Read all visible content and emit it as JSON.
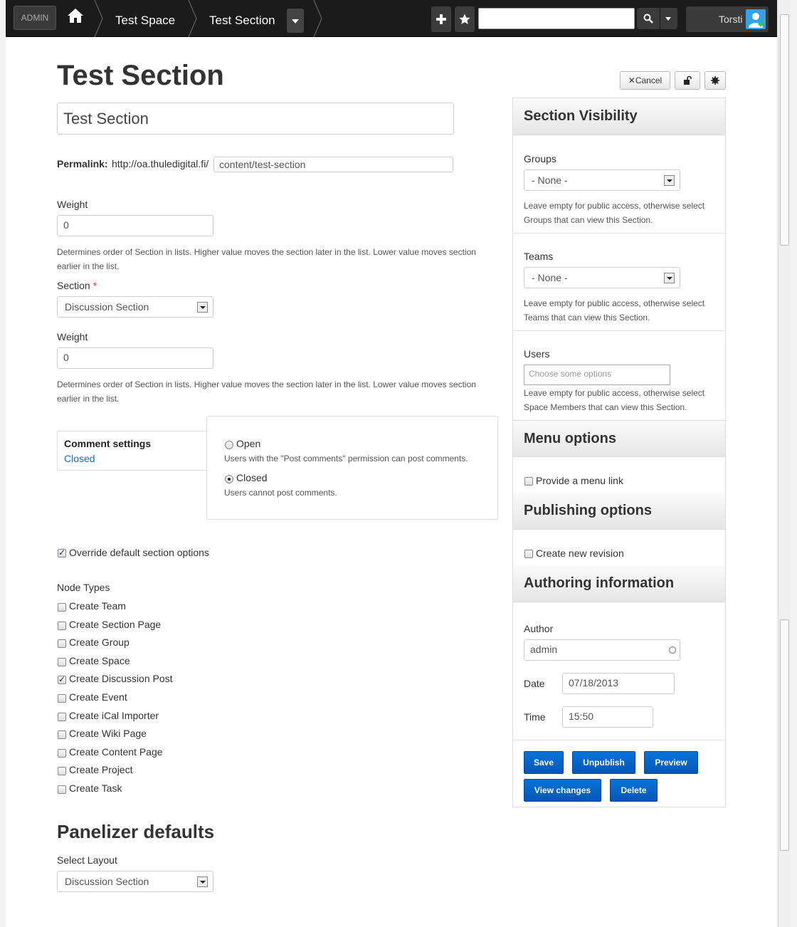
{
  "topbar": {
    "admin_label": "ADMIN",
    "breadcrumbs": [
      "Test Space",
      "Test Section"
    ],
    "user_name": "Torsti"
  },
  "page_title": "Test Section",
  "title_field_value": "Test Section",
  "actions": {
    "cancel_label": "Cancel"
  },
  "permalink": {
    "label": "Permalink:",
    "base": "http://oa.thuledigital.fi/",
    "path": "content/test-section"
  },
  "weight1": {
    "label": "Weight",
    "value": "0",
    "description_line1": "Determines order of Section in lists. Higher value moves the section later in the list. Lower value moves section",
    "description_line2": "earlier in the list."
  },
  "section": {
    "label": "Section",
    "required_mark": "*",
    "value": "Discussion Section"
  },
  "weight2": {
    "label": "Weight",
    "value": "0",
    "description_line1": "Determines order of Section in lists. Higher value moves the section later in the list. Lower value moves section",
    "description_line2": "earlier in the list."
  },
  "comment_settings": {
    "tab_title": "Comment settings",
    "tab_summary": "Closed",
    "open_label": "Open",
    "open_desc": "Users with the \"Post comments\" permission can post comments.",
    "closed_label": "Closed",
    "closed_desc": "Users cannot post comments.",
    "selected": "Closed"
  },
  "override_label": "Override default section options",
  "node_types": {
    "label": "Node Types",
    "items": [
      {
        "label": "Create Team",
        "checked": false
      },
      {
        "label": "Create Section Page",
        "checked": false
      },
      {
        "label": "Create Group",
        "checked": false
      },
      {
        "label": "Create Space",
        "checked": false
      },
      {
        "label": "Create Discussion Post",
        "checked": true
      },
      {
        "label": "Create Event",
        "checked": false
      },
      {
        "label": "Create iCal Importer",
        "checked": false
      },
      {
        "label": "Create Wiki Page",
        "checked": false
      },
      {
        "label": "Create Content Page",
        "checked": false
      },
      {
        "label": "Create Project",
        "checked": false
      },
      {
        "label": "Create Task",
        "checked": false
      }
    ]
  },
  "panelizer": {
    "heading": "Panelizer defaults",
    "layout_label": "Select Layout",
    "layout_value": "Discussion Section"
  },
  "sidebar": {
    "visibility": {
      "heading": "Section Visibility",
      "groups_label": "Groups",
      "groups_value": "- None -",
      "groups_desc1": "Leave empty for public access, otherwise select",
      "groups_desc2": "Groups that can view this Section.",
      "teams_label": "Teams",
      "teams_value": "- None -",
      "teams_desc1": "Leave empty for public access, otherwise select",
      "teams_desc2": "Teams that can view this Section.",
      "users_label": "Users",
      "users_placeholder": "Choose some options",
      "users_desc1": "Leave empty for public access, otherwise select",
      "users_desc2": "Space Members that can view this Section."
    },
    "menu": {
      "heading": "Menu options",
      "provide_link_label": "Provide a menu link"
    },
    "publishing": {
      "heading": "Publishing options",
      "new_revision_label": "Create new revision"
    },
    "authoring": {
      "heading": "Authoring information",
      "author_label": "Author",
      "author_value": "admin",
      "date_label": "Date",
      "date_value": "07/18/2013",
      "time_label": "Time",
      "time_value": "15:50"
    },
    "buttons": {
      "save": "Save",
      "unpublish": "Unpublish",
      "preview": "Preview",
      "view_changes": "View changes",
      "delete": "Delete"
    }
  },
  "colors": {
    "topbar_bg": "#1b1b1b",
    "primary_button": "#0a66c8",
    "link": "#0a74c4",
    "avatar": "#36a1e6"
  }
}
